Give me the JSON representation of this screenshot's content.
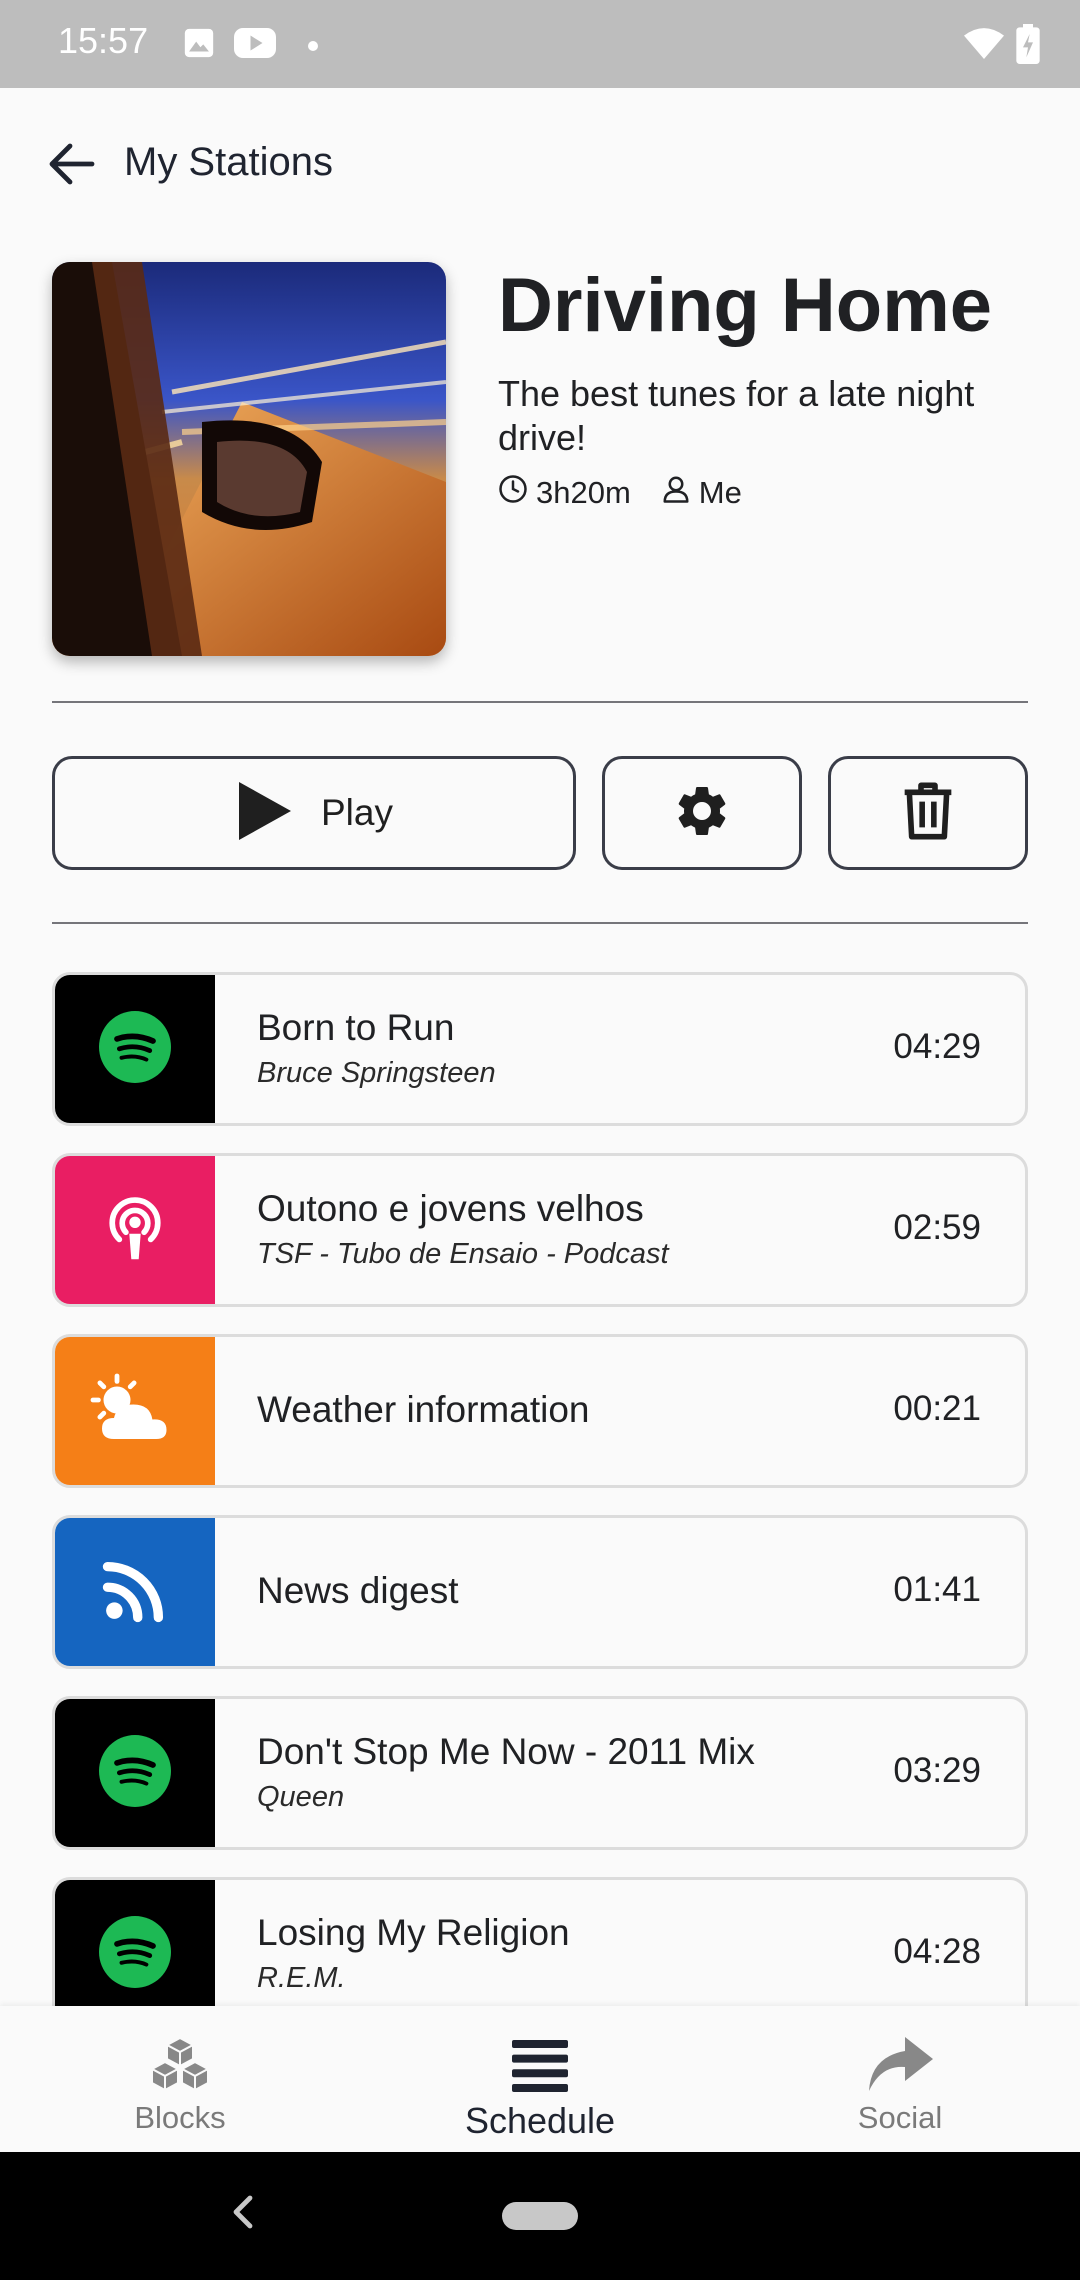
{
  "status_bar": {
    "time": "15:57",
    "icons": [
      "image-icon",
      "youtube-icon",
      "dot-icon",
      "wifi-icon",
      "battery-charging-icon"
    ]
  },
  "app_bar": {
    "back_icon": "arrow-left-icon",
    "title": "My Stations"
  },
  "station": {
    "title": "Driving Home",
    "description": "The best tunes for a late night drive!",
    "duration": "3h20m",
    "owner": "Me",
    "cover_image": "night-driving-car-mirror"
  },
  "actions": {
    "play_label": "Play",
    "settings_icon": "gear-icon",
    "delete_icon": "trash-icon"
  },
  "schedule": [
    {
      "title": "Born to Run",
      "subtitle": "Bruce Springsteen",
      "duration": "04:29",
      "source": "spotify",
      "color": "#000000"
    },
    {
      "title": "Outono e jovens velhos",
      "subtitle": "TSF - Tubo de Ensaio - Podcast",
      "duration": "02:59",
      "source": "podcast",
      "color": "#e91e63"
    },
    {
      "title": "Weather information",
      "subtitle": "",
      "duration": "00:21",
      "source": "weather",
      "color": "#f57f17"
    },
    {
      "title": "News digest",
      "subtitle": "",
      "duration": "01:41",
      "source": "rss",
      "color": "#1565c0"
    },
    {
      "title": "Don't Stop Me Now - 2011 Mix",
      "subtitle": "Queen",
      "duration": "03:29",
      "source": "spotify",
      "color": "#000000"
    },
    {
      "title": "Losing My Religion",
      "subtitle": "R.E.M.",
      "duration": "04:28",
      "source": "spotify",
      "color": "#000000"
    }
  ],
  "bottom_nav": [
    {
      "label": "Blocks",
      "icon": "cubes-icon",
      "active": false
    },
    {
      "label": "Schedule",
      "icon": "list-icon",
      "active": true
    },
    {
      "label": "Social",
      "icon": "share-icon",
      "active": false
    }
  ],
  "colors": {
    "spotify_green": "#1db954",
    "podcast_pink": "#e91e63",
    "weather_orange": "#f57f17",
    "rss_blue": "#1565c0",
    "status_bar": "#bdbdbd"
  }
}
